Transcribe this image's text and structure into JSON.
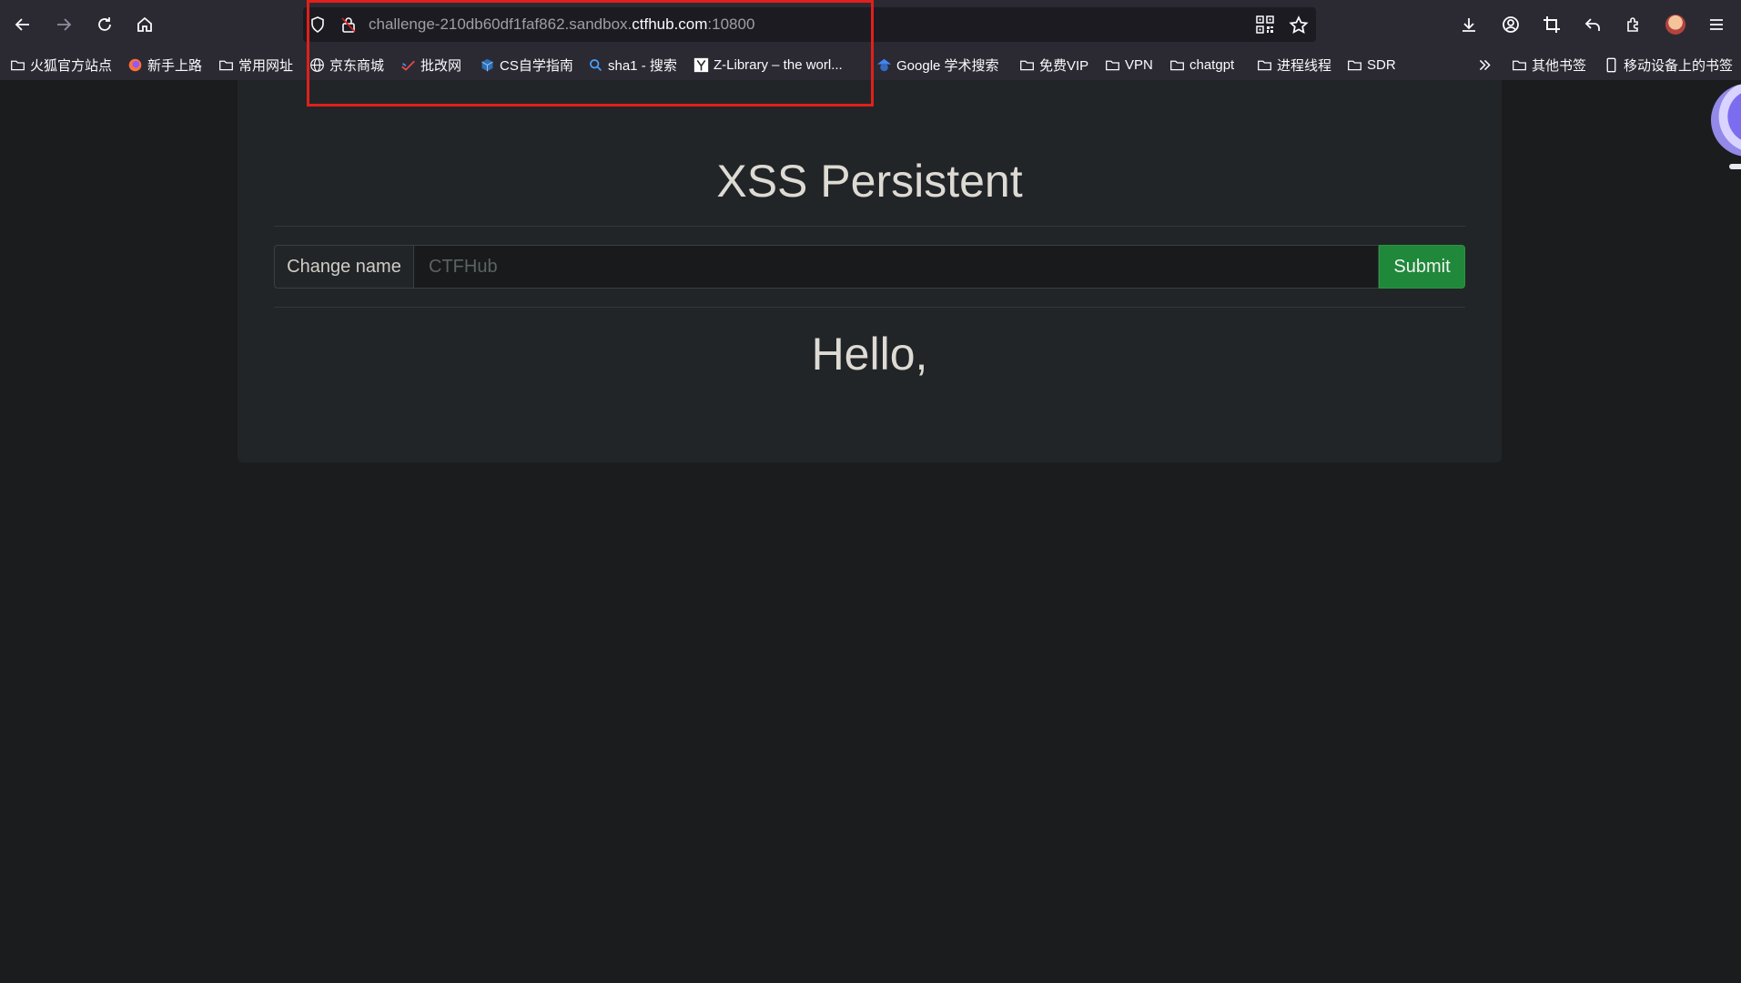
{
  "browser": {
    "url_prefix": "challenge-210db60df1faf862.sandbox.",
    "url_domain": "ctfhub.com",
    "url_suffix": ":10800"
  },
  "bookmarks": {
    "items": [
      {
        "label": "火狐官方站点",
        "icon": "folder-icon"
      },
      {
        "label": "新手上路",
        "icon": "firefox-icon"
      },
      {
        "label": "常用网址",
        "icon": "folder-icon"
      },
      {
        "label": "京东商城",
        "icon": "globe-icon"
      },
      {
        "label": "批改网",
        "icon": "pigai-icon"
      },
      {
        "label": "CS自学指南",
        "icon": "cube-icon"
      },
      {
        "label": "sha1 - 搜索",
        "icon": "search-icon"
      },
      {
        "label": "Z-Library – the worl...",
        "icon": "zlibrary-icon"
      },
      {
        "label": "Google 学术搜索",
        "icon": "scholar-icon"
      },
      {
        "label": "免费VIP",
        "icon": "folder-icon"
      },
      {
        "label": "VPN",
        "icon": "folder-icon"
      },
      {
        "label": "chatgpt",
        "icon": "folder-icon"
      },
      {
        "label": "进程线程",
        "icon": "folder-icon"
      },
      {
        "label": "SDR",
        "icon": "folder-icon"
      }
    ],
    "other_bookmarks": "其他书签",
    "mobile_bookmarks": "移动设备上的书签"
  },
  "page": {
    "title": "XSS Persistent",
    "change_name_label": "Change name",
    "name_placeholder": "CTFHub",
    "submit_label": "Submit",
    "greeting": "Hello,"
  },
  "colors": {
    "highlight": "#e0201b",
    "submit_button": "#20883a",
    "background": "#1b1c1e"
  }
}
